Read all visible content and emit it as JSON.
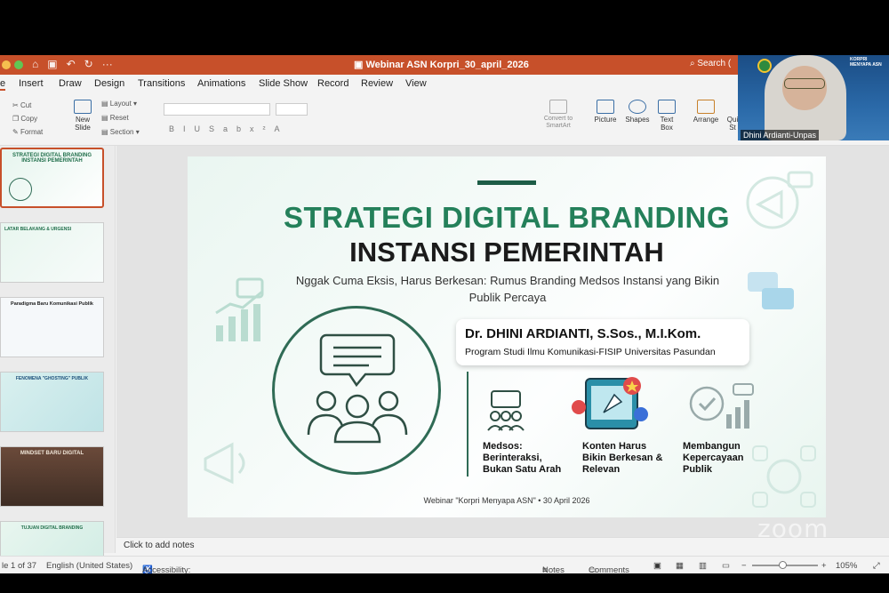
{
  "window": {
    "doc_title": "Webinar ASN Korpri_30_april_2026",
    "search_label": "Search ("
  },
  "menu": {
    "tabs": [
      "e",
      "Insert",
      "Draw",
      "Design",
      "Transitions",
      "Animations",
      "Slide Show",
      "Record",
      "Review",
      "View"
    ]
  },
  "ribbon": {
    "cut": "Cut",
    "copy": "Copy",
    "format": "Format",
    "new_slide": "New Slide",
    "layout": "Layout",
    "reset": "Reset",
    "section": "Section",
    "convert_smartart": "Convert to SmartArt",
    "picture": "Picture",
    "shapes": "Shapes",
    "text_box": "Text Box",
    "arrange": "Arrange",
    "quick_styles": "Qui St"
  },
  "thumbnails": [
    {
      "title": "STRATEGI DIGITAL BRANDING INSTANSI PEMERINTAH"
    },
    {
      "title": "LATAR BELAKANG & URGENSI"
    },
    {
      "title": "Paradigma Baru Komunikasi Publik"
    },
    {
      "title": "FENOMENA \"GHOSTING\" PUBLIK"
    },
    {
      "title": "MINDSET BARU DIGITAL"
    },
    {
      "title": "TUJUAN DIGITAL BRANDING"
    }
  ],
  "slide": {
    "title_line1": "STRATEGI DIGITAL BRANDING",
    "title_line2": "INSTANSI PEMERINTAH",
    "subtitle": "Nggak Cuma Eksis, Harus Berkesan: Rumus Branding Medsos Instansi yang Bikin Publik Percaya",
    "presenter_name": "Dr. DHINI ARDIANTI, S.Sos., M.I.Kom.",
    "presenter_program": "Program Studi Ilmu Komunikasi-FISIP Universitas Pasundan",
    "col1": [
      "Medsos:",
      "Berinteraksi,",
      "Bukan Satu Arah"
    ],
    "col2": [
      "Konten Harus",
      "Bikin Berkesan &",
      "Relevan"
    ],
    "col3": [
      "Membangun",
      "Kepercayaan",
      "Publik"
    ],
    "footer": "Webinar \"Korpri Menyapa ASN\" • 30 April 2026"
  },
  "notes": {
    "placeholder": "Click to add notes"
  },
  "status": {
    "slide_count": "le 1 of 37",
    "language": "English (United States)",
    "accessibility": "Accessibility: Good to go",
    "notes": "Notes",
    "comments": "Comments",
    "zoom": "105%"
  },
  "camera": {
    "participant": "Dhini Ardianti-Unpas",
    "banner": "KORPRI MENYAPA ASN"
  },
  "watermark": "zoom",
  "colors": {
    "titlebar": "#c7502a",
    "slide_green": "#24805a",
    "dark_green": "#2f6b55"
  }
}
